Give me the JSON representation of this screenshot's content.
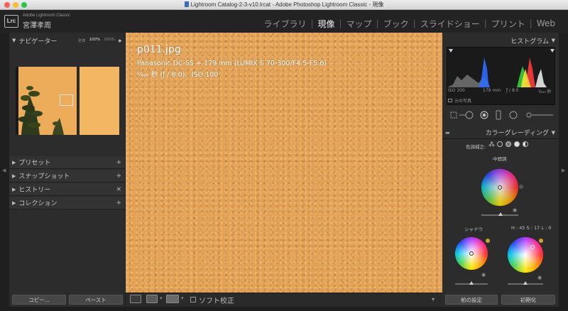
{
  "window": {
    "title": "Lightroom Catalog-2-3-v10.lrcat - Adobe Photoshop Lightroom Classic - 現像"
  },
  "identity": {
    "badge": "Lrc",
    "product": "Adobe Lightroom Classic",
    "user": "宮澤孝周"
  },
  "modules": [
    {
      "label": "ライブラリ",
      "active": false
    },
    {
      "label": "現像",
      "active": true
    },
    {
      "label": "マップ",
      "active": false
    },
    {
      "label": "ブック",
      "active": false
    },
    {
      "label": "スライドショー",
      "active": false
    },
    {
      "label": "プリント",
      "active": false
    },
    {
      "label": "Web",
      "active": false
    }
  ],
  "left_panel": {
    "navigator": {
      "title": "ナビゲーター",
      "zoom_options": [
        "全体",
        "100%",
        "200%"
      ],
      "zoom_selected": "100%"
    },
    "sections": [
      {
        "label": "プリセット",
        "action": "+"
      },
      {
        "label": "スナップショット",
        "action": "+"
      },
      {
        "label": "ヒストリー",
        "action": "×"
      },
      {
        "label": "コレクション",
        "action": "+"
      }
    ],
    "copy_button": "コピー...",
    "paste_button": "ペースト"
  },
  "photo": {
    "filename": "p011.jpg",
    "camera_lens": "Panasonic DC-S5 + 179 mm (LUMIX S 70-300/F4.5-F5.6)",
    "exposure": "¹⁄₄₀₀ 秒 (ƒ / 8.0)、ISO 100",
    "color": "#e4a255"
  },
  "toolbar": {
    "soft_proof_label": "ソフト校正"
  },
  "right_panel": {
    "histogram": {
      "title": "ヒストグラム",
      "iso": "ISO 100",
      "focal": "179 mm",
      "aperture": "ƒ / 8.0",
      "shutter": "¹⁄₄₀₀ 秒",
      "original_label": "元の写真"
    },
    "color_grading": {
      "title": "カラーグレーディング",
      "mode_label": "色調補正:",
      "midtones_label": "中間調",
      "shadows_label": "シャドウ",
      "hsl_readout": "H : 45 S : 17 L : 0"
    },
    "previous_button": "前の設定",
    "reset_button": "初期化"
  },
  "colors": {
    "panel_bg": "#2c2c2c",
    "active_module": "#f2f2f2",
    "inactive_module": "#9a9a9a"
  }
}
